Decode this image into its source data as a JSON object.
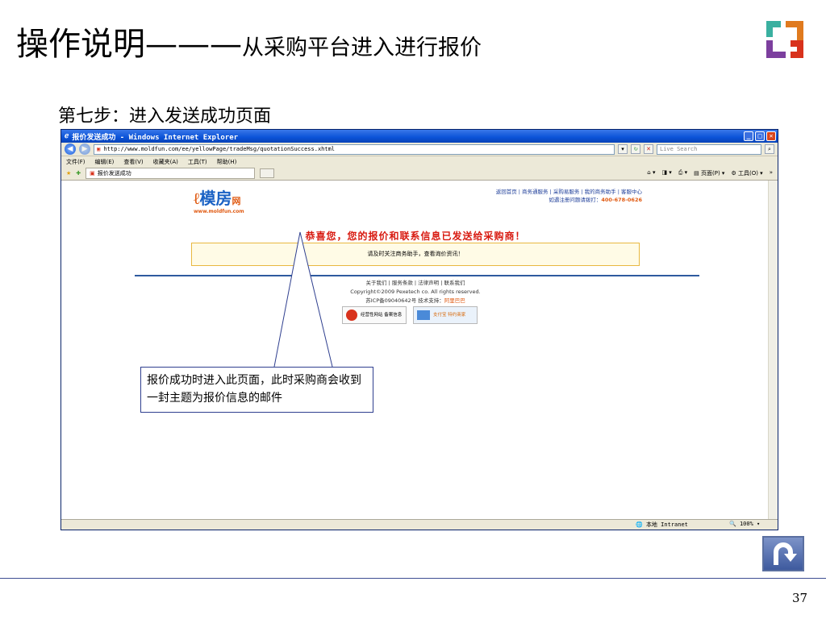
{
  "slide": {
    "title_main": "操作说明———",
    "title_sub": "从采购平台进入进行报价",
    "step": "第七步：进入发送成功页面",
    "callout": "报价成功时进入此页面，此时采购商会收到一封主题为报价信息的邮件",
    "page_number": "37"
  },
  "browser": {
    "window_title": "报价发送成功 - Windows Internet Explorer",
    "address": "http://www.moldfun.com/ee/yellowPage/tradeMsg/quotationSuccess.xhtml",
    "search_placeholder": "Live Search",
    "menu": [
      "文件(F)",
      "编辑(E)",
      "查看(V)",
      "收藏夹(A)",
      "工具(T)",
      "帮助(H)"
    ],
    "tab_label": "报价发送成功",
    "tools_page": "页面(P)",
    "tools_tools": "工具(O)",
    "status_zone": "本地 Intranet",
    "status_zoom": "100%"
  },
  "site": {
    "logo_text": "模房",
    "logo_suffix": "网",
    "logo_url": "www.moldfun.com",
    "top_links": "返回首页 | 商务通服务 | 采购易服务 | 我的商务助手 | 客服中心",
    "hotline_label": "如遇注册问题请拨打：",
    "hotline": "400-678-0626",
    "success_message": "恭喜您，您的报价和联系信息已发送给采购商！",
    "notice": "请及时关注商务助手，查看询价资讯！",
    "footer_links": "关于我们 | 服务条款 | 法律声明 | 联系我们",
    "copyright": "Copyright©2009 Pexetech co. All rights reserved.",
    "icp": "苏ICP备09040642号 技术支持：",
    "tech_support": "阿里巴巴",
    "badge1": "经营性网站 备案信息",
    "badge2": "支付宝 特约商家"
  },
  "colors": {
    "accent": "#d81a10",
    "link": "#1f3f9a",
    "brand_orange": "#e05a12",
    "ie_title": "#0a52d8"
  }
}
